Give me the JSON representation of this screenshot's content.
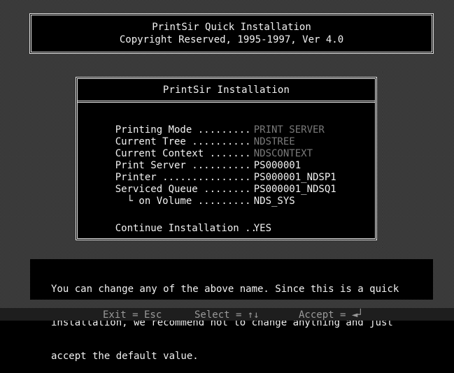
{
  "header": {
    "title": "PrintSir Quick Installation",
    "copyright": "Copyright Reserved, 1995-1997, Ver 4.0"
  },
  "dialog": {
    "title": "PrintSir Installation",
    "rows": [
      {
        "label": "Printing Mode .........",
        "value": "PRINT SERVER"
      },
      {
        "label": "Current Tree ..........",
        "value": "NDSTREE"
      },
      {
        "label": "Current Context .......",
        "value": "NDSCONTEXT"
      },
      {
        "label": "Print Server ..........",
        "value": "PS000001"
      },
      {
        "label": "Printer ...............",
        "value": "PS000001_NDSP1"
      },
      {
        "label": "Serviced Queue ........",
        "value": "PS000001_NDSQ1"
      },
      {
        "label": "  └ on Volume .........",
        "value": "NDS_SYS"
      }
    ],
    "continue": {
      "label": "Continue Installation ..",
      "value": "YES"
    }
  },
  "message": {
    "lines": [
      "You can change any of the above name. Since this is a quick",
      "installation, we recommend not to change anything and just",
      "accept the default value."
    ]
  },
  "status_bar": {
    "exit": "Exit = Esc",
    "select": "Select = ↑↓",
    "accept": "Accept = ◄┘"
  },
  "colors": {
    "background": "#000000",
    "text": "#f2f2f2",
    "disabled_text": "#7a7a7a",
    "dither": "#4a4a4a"
  }
}
